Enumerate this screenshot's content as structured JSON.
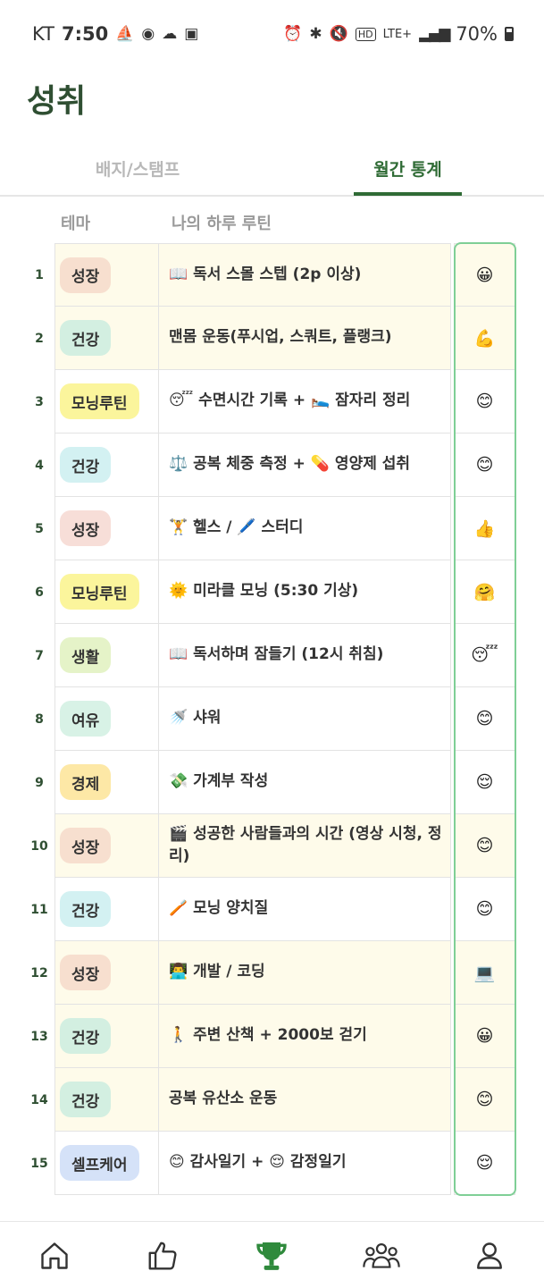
{
  "status": {
    "carrier": "KT",
    "time": "7:50",
    "network": "LTE+",
    "battery": "70%"
  },
  "title": "성취",
  "tabs": [
    {
      "label": "배지/스탬프",
      "active": false
    },
    {
      "label": "월간 통계",
      "active": true
    }
  ],
  "table": {
    "headers": {
      "theme": "테마",
      "routine": "나의 하루 루틴"
    },
    "rows": [
      {
        "num": "1",
        "theme": "성장",
        "theme_color": "#f7dfcf",
        "routine": "📖 독서 스몰 스텝 (2p 이상)",
        "emoji": "😀",
        "highlight": true
      },
      {
        "num": "2",
        "theme": "건강",
        "theme_color": "#d3efe1",
        "routine": "맨몸 운동(푸시업, 스쿼트, 플랭크)",
        "emoji": "💪",
        "highlight": true
      },
      {
        "num": "3",
        "theme": "모닝루틴",
        "theme_color": "#fbf59c",
        "routine": "😴 수면시간 기록 + 🛌 잠자리 정리",
        "emoji": "😊",
        "highlight": false
      },
      {
        "num": "4",
        "theme": "건강",
        "theme_color": "#d3f1f2",
        "routine": "⚖️ 공복 체중 측정 + 💊 영양제 섭취",
        "emoji": "😊",
        "highlight": false
      },
      {
        "num": "5",
        "theme": "성장",
        "theme_color": "#f7ded8",
        "routine": "🏋️ 헬스 / 🖊️ 스터디",
        "emoji": "👍",
        "highlight": false
      },
      {
        "num": "6",
        "theme": "모닝루틴",
        "theme_color": "#fbf59c",
        "routine": "🌞 미라클 모닝 (5:30 기상)",
        "emoji": "🤗",
        "highlight": false
      },
      {
        "num": "7",
        "theme": "생활",
        "theme_color": "#e5f3c8",
        "routine": "📖 독서하며 잠들기 (12시 취침)",
        "emoji": "😴",
        "highlight": false
      },
      {
        "num": "8",
        "theme": "여유",
        "theme_color": "#d8f2e6",
        "routine": "🚿 샤워",
        "emoji": "😊",
        "highlight": false
      },
      {
        "num": "9",
        "theme": "경제",
        "theme_color": "#fde8a6",
        "routine": "💸 가계부 작성",
        "emoji": "😌",
        "highlight": false
      },
      {
        "num": "10",
        "theme": "성장",
        "theme_color": "#f7dfcf",
        "routine": "🎬 성공한 사람들과의 시간 (영상 시청, 정리)",
        "emoji": "😊",
        "highlight": true
      },
      {
        "num": "11",
        "theme": "건강",
        "theme_color": "#d3f1f2",
        "routine": "🪥 모닝 양치질",
        "emoji": "😊",
        "highlight": false
      },
      {
        "num": "12",
        "theme": "성장",
        "theme_color": "#f7dfcf",
        "routine": "👨‍💻 개발 / 코딩",
        "emoji": "💻",
        "highlight": true
      },
      {
        "num": "13",
        "theme": "건강",
        "theme_color": "#d3efe1",
        "routine": "🚶 주변 산책 + 2000보 걷기",
        "emoji": "😀",
        "highlight": true
      },
      {
        "num": "14",
        "theme": "건강",
        "theme_color": "#d3efe1",
        "routine": "공복 유산소 운동",
        "emoji": "😊",
        "highlight": true
      },
      {
        "num": "15",
        "theme": "셀프케어",
        "theme_color": "#d5e2f8",
        "routine": "😊 감사일기 + 😌 감정일기",
        "emoji": "😌",
        "highlight": false
      }
    ]
  },
  "nav": [
    {
      "icon": "home-icon",
      "active": false
    },
    {
      "icon": "thumbs-up-icon",
      "active": false
    },
    {
      "icon": "trophy-icon",
      "active": true,
      "color": "#2f8a3c"
    },
    {
      "icon": "group-icon",
      "active": false
    },
    {
      "icon": "profile-icon",
      "active": false
    }
  ]
}
